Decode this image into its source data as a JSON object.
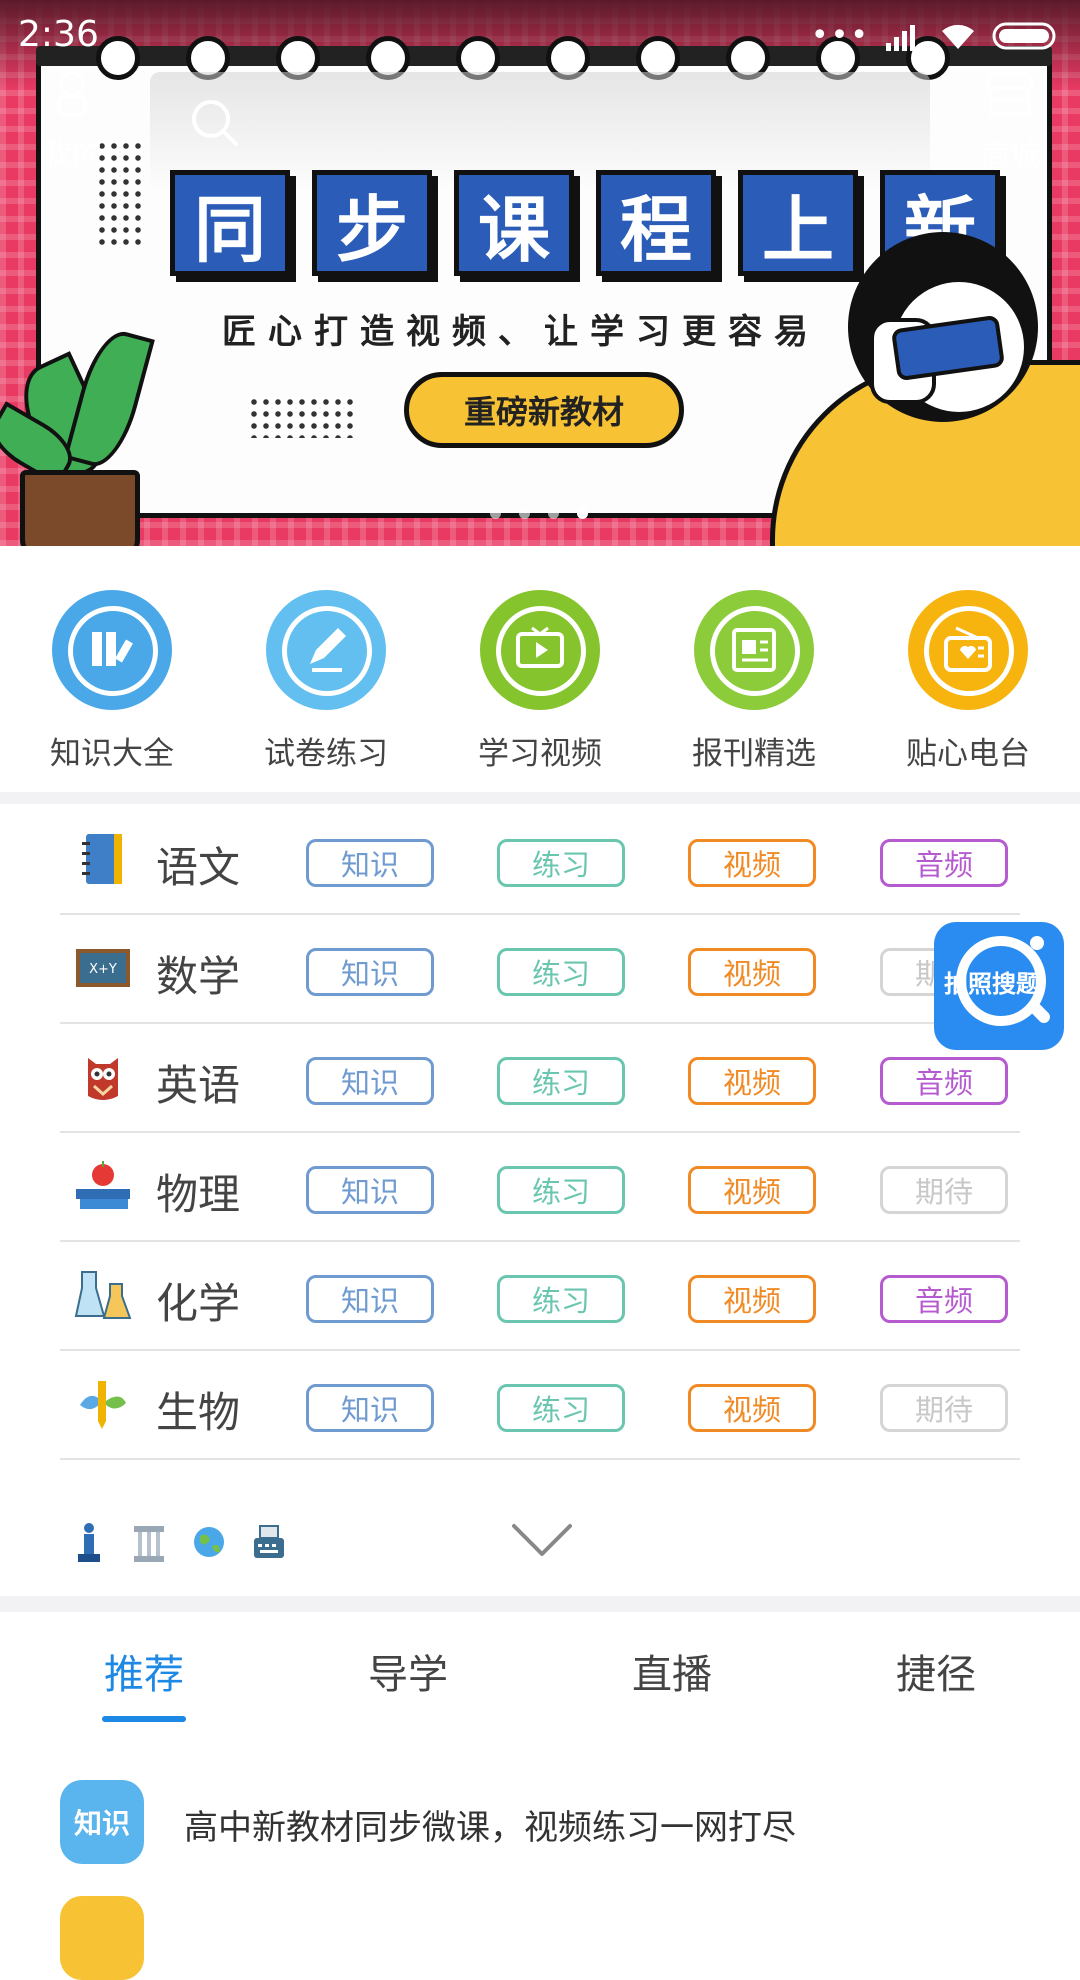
{
  "status_bar": {
    "time": "2:36"
  },
  "header": {
    "mine_label": "我的",
    "mall_label": "商城"
  },
  "banner": {
    "title_chars": [
      "同",
      "步",
      "课",
      "程",
      "上",
      "新"
    ],
    "subtitle": "匠心打造视频、让学习更容易",
    "button_label": "重磅新教材",
    "slide_count": 4,
    "active_slide": 4
  },
  "quick_entries": [
    {
      "label": "知识大全",
      "icon": "books-icon",
      "color": "#4aa8e8"
    },
    {
      "label": "试卷练习",
      "icon": "pencil-icon",
      "color": "#62bff0"
    },
    {
      "label": "学习视频",
      "icon": "tv-play-icon",
      "color": "#86c42d"
    },
    {
      "label": "报刊精选",
      "icon": "newspaper-icon",
      "color": "#8ccb3a"
    },
    {
      "label": "贴心电台",
      "icon": "radio-icon",
      "color": "#f7b40e"
    }
  ],
  "subjects": [
    {
      "name": "语文",
      "icon": "notebook-icon",
      "tags": [
        "知识",
        "练习",
        "视频",
        "音频"
      ],
      "last_enabled": true
    },
    {
      "name": "数学",
      "icon": "blackboard-icon",
      "tags": [
        "知识",
        "练习",
        "视频",
        "期待"
      ],
      "last_enabled": false
    },
    {
      "name": "英语",
      "icon": "owl-icon",
      "tags": [
        "知识",
        "练习",
        "视频",
        "音频"
      ],
      "last_enabled": true
    },
    {
      "name": "物理",
      "icon": "apple-books-icon",
      "tags": [
        "知识",
        "练习",
        "视频",
        "期待"
      ],
      "last_enabled": false
    },
    {
      "name": "化学",
      "icon": "flask-icon",
      "tags": [
        "知识",
        "练习",
        "视频",
        "音频"
      ],
      "last_enabled": true
    },
    {
      "name": "生物",
      "icon": "leaf-pencil-icon",
      "tags": [
        "知识",
        "练习",
        "视频",
        "期待"
      ],
      "last_enabled": false
    }
  ],
  "more_subject_icons": [
    "chess-icon",
    "pillar-icon",
    "globe-icon",
    "typewriter-icon"
  ],
  "floating_button": {
    "label": "拍照搜题"
  },
  "tabs": [
    {
      "label": "推荐",
      "active": true
    },
    {
      "label": "导学",
      "active": false
    },
    {
      "label": "直播",
      "active": false
    },
    {
      "label": "捷径",
      "active": false
    }
  ],
  "feed": [
    {
      "badge": "知识",
      "badge_color": "#5ab4ee",
      "text": "高中新教材同步微课，视频练习一网打尽"
    },
    {
      "badge": "",
      "badge_color": "#f7c233",
      "text": ""
    }
  ],
  "colors": {
    "accent": "#1e88e5",
    "banner_bg": "#e93a63"
  }
}
